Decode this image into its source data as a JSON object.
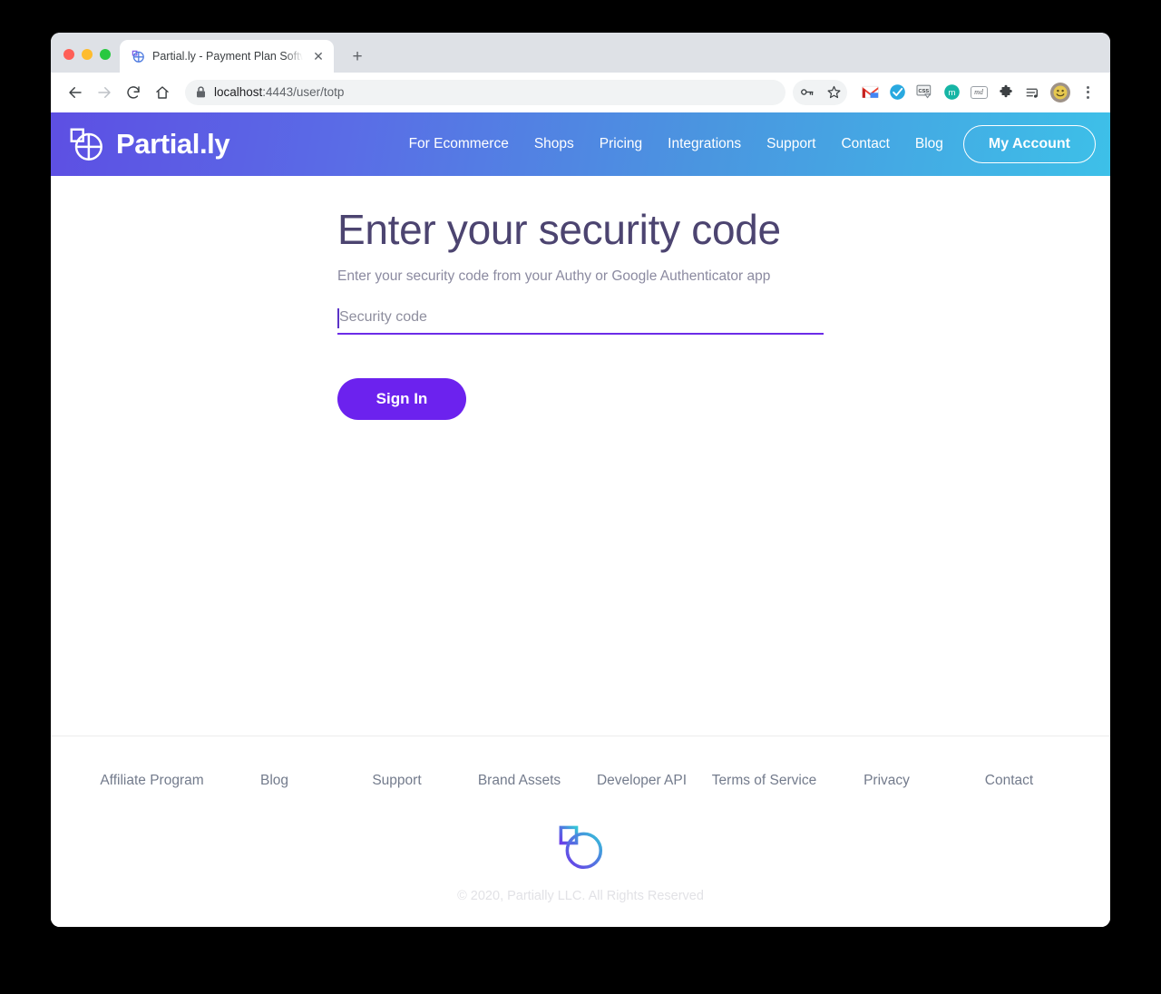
{
  "browser": {
    "tab": {
      "title": "Partial.ly - Payment Plan Softwa",
      "favicon_icon": "partially-logo-icon",
      "close_icon": "close-icon"
    },
    "new_tab_label": "+",
    "nav": {
      "back_icon": "back-arrow-icon",
      "forward_icon": "forward-arrow-icon",
      "reload_icon": "reload-icon",
      "home_icon": "home-icon"
    },
    "omnibox": {
      "lock_icon": "lock-icon",
      "url_host": "localhost",
      "url_rest": ":4443/user/totp",
      "url_full": "localhost:4443/user/totp"
    },
    "toolbar_icons": [
      {
        "name": "password-key-icon",
        "label": ""
      },
      {
        "name": "bookmark-star-icon",
        "label": ""
      },
      {
        "name": "gmail-extension-icon",
        "label": "M"
      },
      {
        "name": "checkmark-extension-icon",
        "label": ""
      },
      {
        "name": "css-extension-icon",
        "label": "CSS"
      },
      {
        "name": "mailtrack-extension-icon",
        "label": "m"
      },
      {
        "name": "markdown-extension-icon",
        "label": "md"
      },
      {
        "name": "puzzle-extensions-icon",
        "label": ""
      },
      {
        "name": "reading-list-icon",
        "label": ""
      },
      {
        "name": "profile-avatar-icon",
        "label": ""
      },
      {
        "name": "chrome-menu-icon",
        "label": ""
      }
    ]
  },
  "site": {
    "brand": {
      "name": "Partial.ly",
      "logo_icon": "partially-logo-icon"
    },
    "nav_items": [
      {
        "label": "For Ecommerce"
      },
      {
        "label": "Shops"
      },
      {
        "label": "Pricing"
      },
      {
        "label": "Integrations"
      },
      {
        "label": "Support"
      },
      {
        "label": "Contact"
      },
      {
        "label": "Blog"
      }
    ],
    "account_button": "My Account",
    "header_gradient_from": "#5d4fe3",
    "header_gradient_to": "#3dc0e8"
  },
  "main": {
    "title": "Enter your security code",
    "subtitle": "Enter your security code from your Authy or Google Authenticator app",
    "security_code_field": {
      "placeholder": "Security code",
      "value": ""
    },
    "submit_button": "Sign In",
    "accent_color": "#6c22ee"
  },
  "footer": {
    "links": [
      {
        "label": "Affiliate Program"
      },
      {
        "label": "Blog"
      },
      {
        "label": "Support"
      },
      {
        "label": "Brand Assets"
      },
      {
        "label": "Developer API"
      },
      {
        "label": "Terms of Service"
      },
      {
        "label": "Privacy"
      },
      {
        "label": "Contact"
      }
    ],
    "logo_icon": "partially-logo-icon",
    "copyright": "© 2020, Partially LLC. All Rights Reserved"
  }
}
